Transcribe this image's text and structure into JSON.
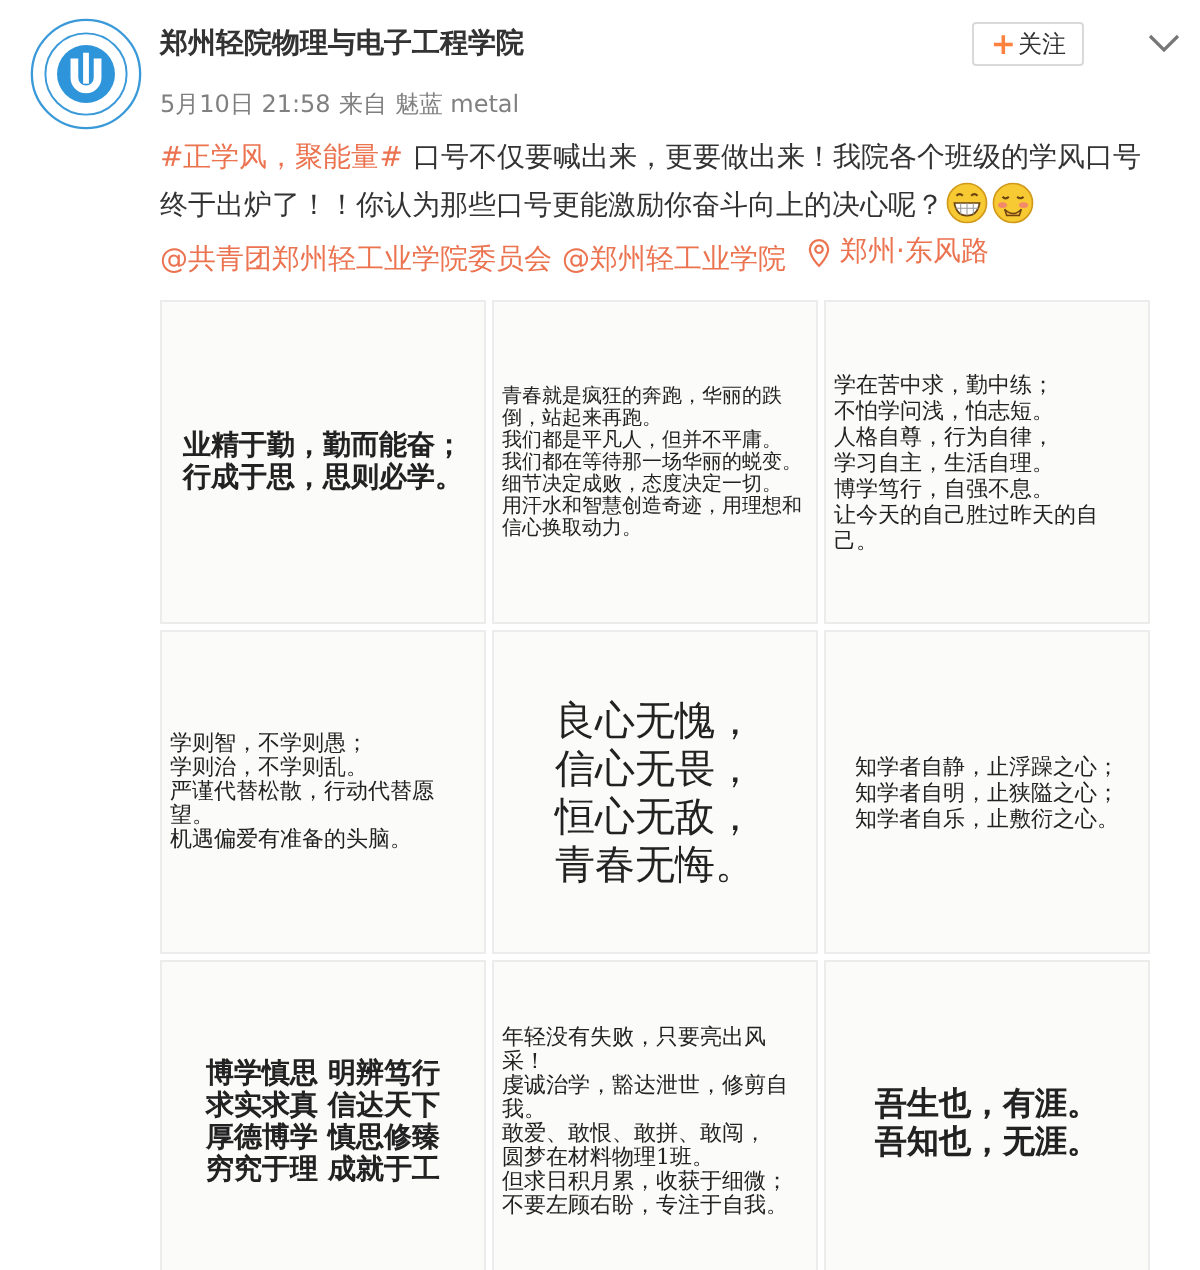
{
  "author": {
    "name": "郑州轻院物理与电子工程学院",
    "follow_label": "关注",
    "follow_mark": "+"
  },
  "meta": {
    "time": "5月10日 21:58",
    "source_prefix": "来自",
    "source": "魅蓝 metal"
  },
  "body": [
    {
      "kind": "topic",
      "text": "#正学风，聚能量#"
    },
    {
      "kind": "text",
      "text": "口号不仅要喊出来，更要做出来！我院各个班级的学风口号终于出炉了！！你认为那些口号更能激励你奋斗向上的决心呢？"
    },
    {
      "kind": "grin"
    },
    {
      "kind": "blush"
    },
    {
      "kind": "mention",
      "text": "@共青团郑州轻工业学院委员会"
    },
    {
      "kind": "mention",
      "text": "@郑州轻工业学院"
    },
    {
      "kind": "location",
      "text": "郑州·东风路"
    }
  ],
  "images": [
    {
      "kind": "large",
      "lines": [
        "业精于勤，勤而能奋；",
        "行成于思，思则必学。"
      ]
    },
    {
      "kind": "tiny",
      "lines": [
        "青春就是疯狂的奔跑，华丽的跌倒，站起来再跑。",
        "我们都是平凡人，但并不平庸。",
        "我们都在等待那一场华丽的蜕变。",
        "细节决定成败，态度决定一切。",
        "用汗水和智慧创造奇迹，用理想和信心换取动力。"
      ]
    },
    {
      "kind": "medium",
      "lines": [
        "学在苦中求，勤中练；",
        "不怕学问浅，怕志短。",
        "人格自尊，行为自律，",
        "学习自主，生活自理。",
        "博学笃行，自强不息。",
        "让今天的自己胜过昨天的自己。"
      ]
    },
    {
      "kind": "small",
      "lines": [
        "学则智，不学则愚；",
        "学则治，不学则乱。",
        "严谨代替松散，行动代替愿望。",
        "机遇偏爱有准备的头脑。"
      ]
    },
    {
      "kind": "huge",
      "lines": [
        "良心无愧，",
        "信心无畏，",
        "恒心无敌，",
        "青春无悔。"
      ]
    },
    {
      "kind": "medium",
      "lines": [
        "知学者自静，止浮躁之心；",
        "知学者自明，止狭隘之心；",
        "知学者自乐，止敷衍之心。"
      ]
    },
    {
      "kind": "large",
      "lines": [
        "博学慎思 明辨笃行",
        "求实求真 信达天下",
        "厚德博学 慎思修臻",
        "穷究于理 成就于工"
      ]
    },
    {
      "kind": "small",
      "lines": [
        "年轻没有失败，只要亮出风采！",
        "虔诚治学，豁达泄世，修剪自我。",
        "敢爱、敢恨、敢拼、敢闯，",
        "圆梦在材料物理1班。",
        "但求日积月累，收获于细微；",
        "不要左顾右盼，专注于自我。"
      ]
    },
    {
      "kind": "xlarge",
      "lines": [
        "吾生也，有涯。",
        "吾知也，无涯。"
      ]
    }
  ]
}
